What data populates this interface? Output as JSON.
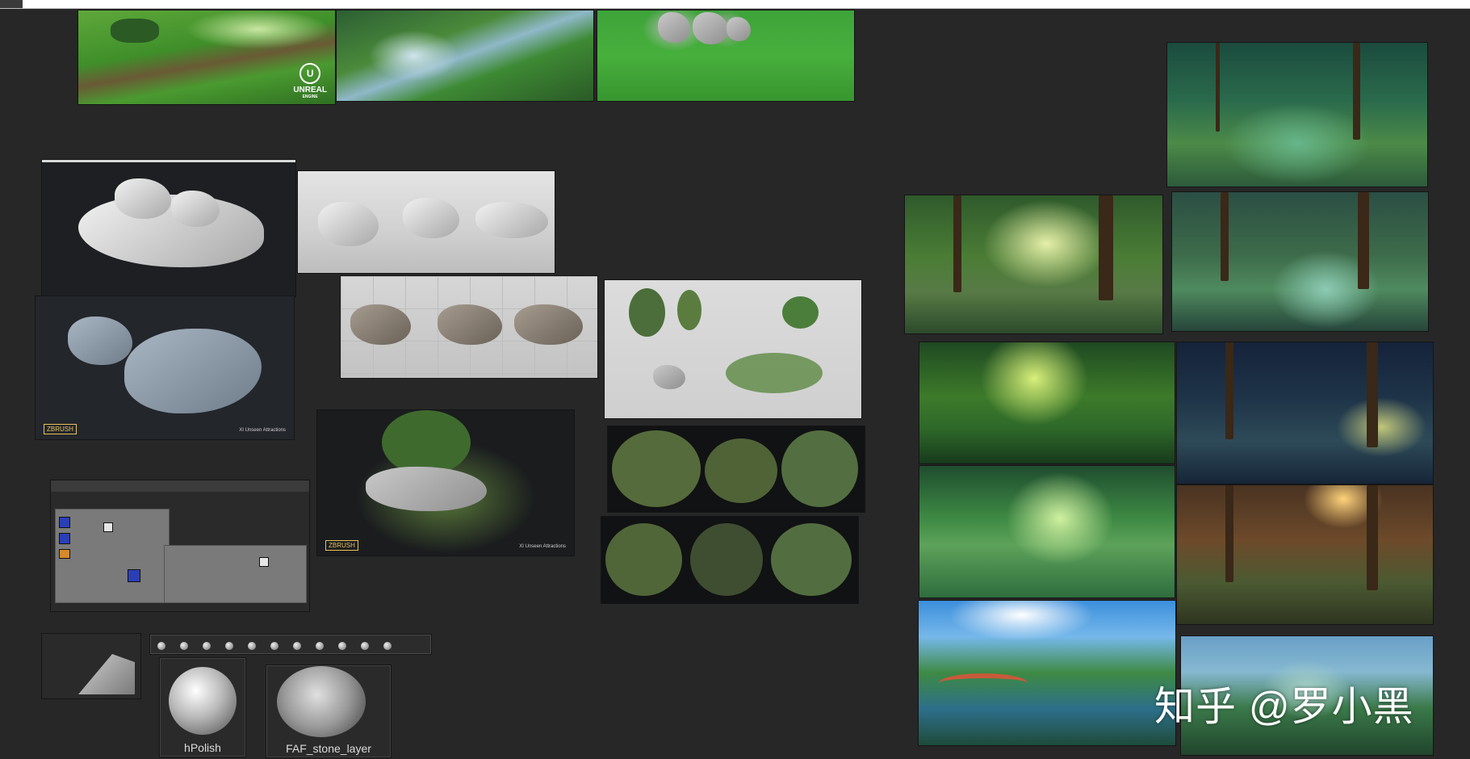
{
  "board": {
    "background": "#272727",
    "watermark": "知乎 @罗小黑"
  },
  "refs": {
    "top_left": {
      "logo_text": "UNREAL",
      "logo_subtext": "ENGINE"
    },
    "zbrush_stone": {
      "badge": "ZBRUSH",
      "credit": "XI Unseen Attractions"
    },
    "zbrush_diorama": {
      "badge": "ZBRUSH",
      "credit": "XI Unseen Attractions"
    }
  },
  "materials": {
    "tile1_label": "hPolish",
    "tile2_label": "FAF_stone_layer"
  },
  "colors": {
    "accent_grass": "#47b03c",
    "accent_node_blue": "#2a3fb5",
    "accent_node_orange": "#d38a2a"
  }
}
